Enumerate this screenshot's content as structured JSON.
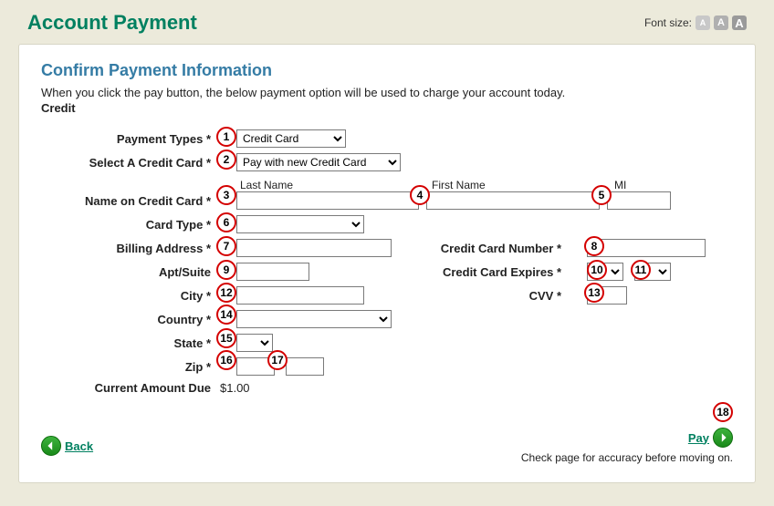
{
  "header": {
    "title": "Account Payment",
    "font_size_label": "Font size:",
    "fs_btn": "A"
  },
  "section": {
    "title": "Confirm Payment Information",
    "instruction": "When you click the pay button, the below payment option will be used to charge your account today.",
    "subheading": "Credit"
  },
  "labels": {
    "payment_types": "Payment Types",
    "select_cc": "Select A Credit Card",
    "name_on_cc": "Name on Credit Card",
    "last_name": "Last Name",
    "first_name": "First Name",
    "mi": "MI",
    "card_type": "Card Type",
    "billing_address": "Billing Address",
    "apt_suite": "Apt/Suite",
    "city": "City",
    "country": "Country",
    "state": "State",
    "zip": "Zip",
    "current_amount_due": "Current Amount Due",
    "cc_number": "Credit Card Number",
    "cc_expires": "Credit Card Expires",
    "cvv": "CVV"
  },
  "values": {
    "payment_type_selected": "Credit Card",
    "select_cc_selected": "Pay with new Credit Card",
    "last_name": "",
    "first_name": "",
    "mi": "",
    "card_type_selected": "",
    "billing_address": "",
    "apt_suite": "",
    "city": "",
    "country_selected": "",
    "state_selected": "",
    "zip1": "",
    "zip2": "",
    "current_amount_due": "$1.00",
    "cc_number": "",
    "exp_month_selected": "",
    "exp_year_selected": "",
    "cvv": ""
  },
  "footer": {
    "back": "Back",
    "pay": "Pay",
    "note": "Check page for accuracy before moving on."
  },
  "badges": [
    "1",
    "2",
    "3",
    "4",
    "5",
    "6",
    "7",
    "8",
    "9",
    "10",
    "11",
    "12",
    "13",
    "14",
    "15",
    "16",
    "17",
    "18"
  ]
}
